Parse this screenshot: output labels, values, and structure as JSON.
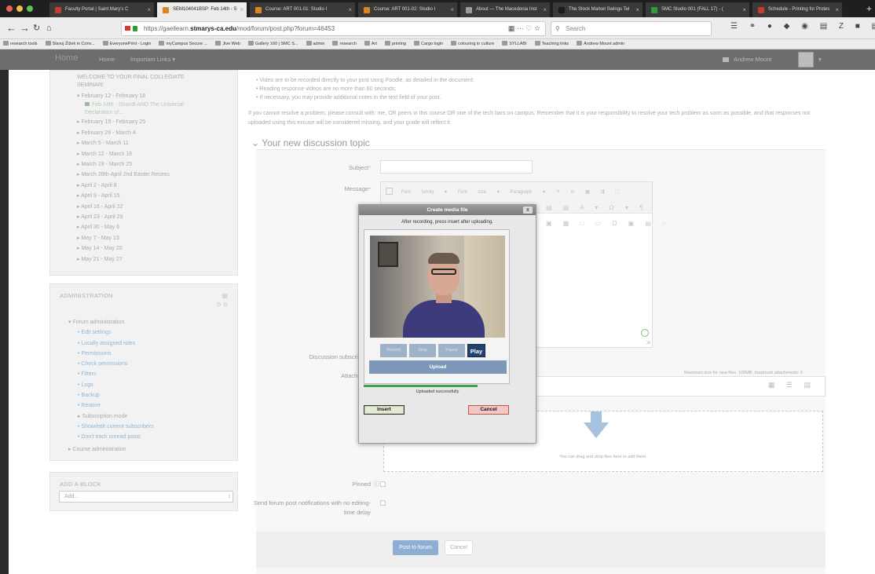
{
  "browser": {
    "tabs": [
      {
        "label": "Faculty Portal | Saint Mary's C",
        "color": "#c53b2e"
      },
      {
        "label": "SEM104041BSP: Feb 14th - S",
        "color": "#d9861c"
      },
      {
        "label": "Course: ART 001-01: Studio I",
        "color": "#d9861c"
      },
      {
        "label": "Course: ART 001-02: Studio I",
        "color": "#d9861c"
      },
      {
        "label": "About — The Macedonia Inst",
        "color": "#9b9b9b"
      },
      {
        "label": "The Stock Market Swings Tel",
        "color": "#1a1a1a"
      },
      {
        "label": "SMC Studio 001 (FALL 17) - (",
        "color": "#2d9d3b"
      },
      {
        "label": "Schedule - Printing for Protes",
        "color": "#c53b2e"
      }
    ],
    "url_prefix": "https://gaellearn.",
    "url_domain": "stmarys-ca.edu",
    "url_path": "/mod/forum/post.php?forum=46453",
    "search_placeholder": "Search",
    "bookmarks": [
      "research tools",
      "Slavoj Žižek in Conv...",
      "EveryonePrint - Login",
      "myCampus Secure ...",
      "Jive Web",
      "Gallery 160 | SMC S...",
      "admin",
      "research",
      "Art",
      "printing",
      "Cargo login",
      "colouring in culture",
      "SYLLABI",
      "Teaching links",
      "Andrew Mount admin"
    ]
  },
  "header": {
    "brand": "Home",
    "nav_home": "Home",
    "nav_links": "Important Links",
    "user_name": "Andrew Mount"
  },
  "sidebar": {
    "welcome": "WELCOME TO YOUR FINAL COLLEGIATE SEMINAR!",
    "current_week": "February 12 - February 18",
    "current_sub": "Feb 14th - Shandi AND The Universal Declaration of...",
    "weeks": [
      "February 19 - February 25",
      "February 26 - March 4",
      "March 5 - March 11",
      "March 12 - March 18",
      "March 19 - March 25",
      "March 26th-April 2nd Easter Recess",
      "April 2 - April 8",
      "April 9 - April 15",
      "April 16 - April 22",
      "April 23 - April 29",
      "April 30 - May 6",
      "May 7 - May 13",
      "May 14 - May 20",
      "May 21 - May 27"
    ],
    "admin_title": "ADMINISTRATION",
    "admin_head": "Forum administration",
    "admin_items": [
      "Edit settings",
      "Locally assigned roles",
      "Permissions",
      "Check permissions",
      "Filters",
      "Logs",
      "Backup",
      "Restore"
    ],
    "subscription": "Subscription mode",
    "subscription_items": [
      "Show/edit current subscribers",
      "Don't track unread posts"
    ],
    "course_admin": "Course administration",
    "add_block_title": "ADD A BLOCK",
    "add_placeholder": "Add..."
  },
  "main": {
    "rules": [
      "Video are to be recorded directly to your post using Poodle, as detailed in the document;",
      "Reading response videos are no more than 60 seconds;",
      "If necessary, you may provide additional notes in the text field of your post."
    ],
    "paragraph": "If you cannot resolve a problem, please consult with: me, OR peers in this course OR one of the tech bars on campus. Remember that it is your responsibility to resolve your tech problem as soon as possible, and that responses not uploaded using this excuse will be considered missing, and your grade will reflect it.",
    "section_title": "Your new discussion topic",
    "subject_label": "Subject",
    "message_label": "Message",
    "toolbar_font_family": "Font family",
    "toolbar_font_size": "Font size",
    "toolbar_paragraph": "Paragraph",
    "discussion_label": "Discussion subscription",
    "attachment_label": "Attachment",
    "max_size": "Maximum size for new files: 100MB, maximum attachments: 9",
    "drop_text": "You can drag and drop files here to add them.",
    "pinned_label": "Pinned",
    "notify_label": "Send forum post notifications with no editing-time delay",
    "post_button": "Post to forum",
    "cancel_button": "Cancel"
  },
  "dialog": {
    "title": "Create media file",
    "close": "x",
    "instructions": "After recording, press insert after uploading.",
    "btn_record": "Record",
    "btn_stop": "Stop",
    "btn_pause": "Pause",
    "btn_play": "Play",
    "btn_upload": "Upload",
    "upload_progress": 1.0,
    "status": "Uploaded successfully",
    "insert": "Insert",
    "cancel": "Cancel"
  }
}
